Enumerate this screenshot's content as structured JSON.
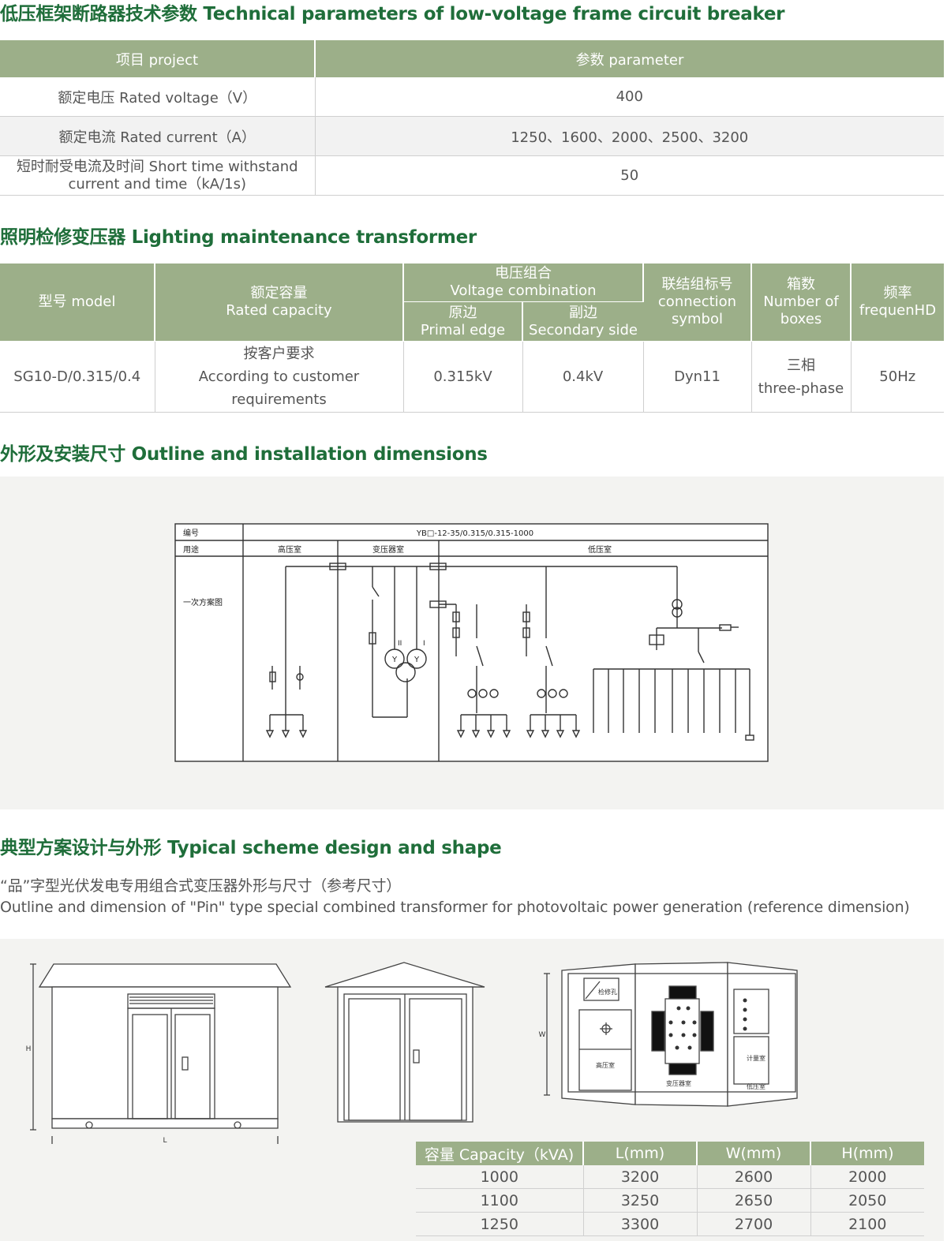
{
  "section1": {
    "title": "低压框架断路器技术参数 Technical parameters of low-voltage frame circuit breaker",
    "headers": [
      "项目 project",
      "参数 parameter"
    ],
    "rows": [
      {
        "item": "额定电压 Rated voltage（V）",
        "value": "400"
      },
      {
        "item": "额定电流 Rated current（A）",
        "value": "1250、1600、2000、2500、3200"
      },
      {
        "item_line1": "短时耐受电流及时间 Short time withstand",
        "item_line2": "current and time（kA/1s)",
        "value": "50"
      }
    ]
  },
  "section2": {
    "title": "照明检修变压器 Lighting maintenance transformer",
    "headers": {
      "model": "型号 model",
      "capacity_cn": "额定容量",
      "capacity_en": "Rated capacity",
      "voltage_cn": "电压组合",
      "voltage_en": "Voltage combination",
      "primal_cn": "原边",
      "primal_en": "Primal edge",
      "secondary_cn": "副边",
      "secondary_en": "Secondary side",
      "symbol_cn": "联结组标号",
      "symbol_en1": "connection",
      "symbol_en2": "symbol",
      "boxes_cn": "箱数",
      "boxes_en1": "Number of",
      "boxes_en2": "boxes",
      "freq_cn": "频率",
      "freq_en": "frequenHD"
    },
    "row": {
      "model": "SG10-D/0.315/0.4",
      "capacity_cn": "按客户要求",
      "capacity_en1": "According to customer",
      "capacity_en2": "requirements",
      "primal": "0.315kV",
      "secondary": "0.4kV",
      "symbol": "Dyn11",
      "boxes_cn": "三相",
      "boxes_en": "three-phase",
      "freq": "50Hz"
    }
  },
  "section3": {
    "title": "外形及安装尺寸 Outline and installation dimensions",
    "diagram": {
      "label_number": "编号",
      "label_use": "用途",
      "model_code": "YB□-12-35/0.315/0.315-1000",
      "room_high": "高压室",
      "room_transformer": "变压器室",
      "room_low": "低压室",
      "label_scheme": "一次方案图",
      "winding_2": "II",
      "winding_1": "I",
      "winding_symbol": "Y"
    }
  },
  "section4": {
    "title": "典型方案设计与外形 Typical scheme design and shape",
    "desc_cn": "“品”字型光伏发电专用组合式变压器外形与尺寸（参考尺寸）",
    "desc_en": "Outline and dimension of \"Pin\" type special combined transformer for photovoltaic power generation (reference dimension)",
    "drawing_labels": {
      "dim_h": "H",
      "dim_l": "L",
      "dim_w": "W",
      "inspection_hole": "检修孔",
      "high_room": "高压室",
      "transformer_room": "变压器室",
      "low_room": "低压室",
      "meter_room": "计量室"
    },
    "table": {
      "headers": [
        "容量 Capacity（kVA)",
        "L(mm)",
        "W(mm)",
        "H(mm)"
      ],
      "rows": [
        [
          "1000",
          "3200",
          "2600",
          "2000"
        ],
        [
          "1100",
          "3250",
          "2650",
          "2050"
        ],
        [
          "1250",
          "3300",
          "2700",
          "2100"
        ]
      ]
    }
  },
  "colors": {
    "title_green": "#1f6e3a",
    "header_green": "#9caf89",
    "panel_gray": "#f3f3f1"
  }
}
